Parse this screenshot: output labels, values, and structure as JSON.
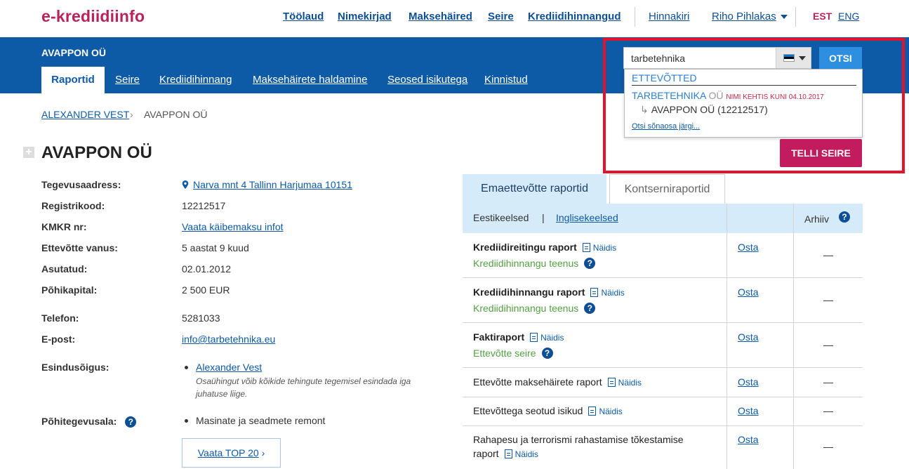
{
  "header": {
    "logo": "e-krediidiinfo",
    "nav": [
      "Töölaud",
      "Nimekirjad",
      "Maksehäired",
      "Seire",
      "Krediidihinnangud"
    ],
    "price_list": "Hinnakiri",
    "user": "Riho Pihlakas",
    "lang_active": "EST",
    "lang_other": "ENG"
  },
  "band": {
    "company": "AVAPPON OÜ",
    "tabs": [
      "Raportid",
      "Seire",
      "Krediidihinnang",
      "Maksehäirete haldamine",
      "Seosed isikutega",
      "Kinnistud"
    ]
  },
  "search": {
    "value": "tarbetehnika",
    "button": "OTSI",
    "dropdown": {
      "heading": "ETTEVÕTTED",
      "result_name": "TARBETEHNIKA",
      "result_suffix": "OÜ",
      "result_note": "NIMI KEHTIS KUNI 04.10.2017",
      "result_current": "AVAPPON OÜ (12212517)",
      "more_link": "Otsi sõnaosa järgi..."
    },
    "monitor_button": "TELLI SEIRE"
  },
  "breadcrumb": {
    "parent": "ALEXANDER VEST",
    "current": "AVAPPON OÜ"
  },
  "company": {
    "title": "AVAPPON OÜ",
    "fields": {
      "address_label": "Tegevusaadress:",
      "address": "Narva mnt 4 Tallinn Harjumaa 10151",
      "regcode_label": "Registrikood:",
      "regcode": "12212517",
      "vat_label": "KMKR nr:",
      "vat": "Vaata käibemaksu infot",
      "age_label": "Ettevõtte vanus:",
      "age": "5 aastat 9 kuud",
      "founded_label": "Asutatud:",
      "founded": "02.01.2012",
      "capital_label": "Põhikapital:",
      "capital": "2 500 EUR",
      "phone_label": "Telefon:",
      "phone": "5281033",
      "email_label": "E-post:",
      "email": "info@tarbetehnika.eu",
      "rep_label": "Esindusõigus:",
      "rep_name": "Alexander Vest",
      "rep_note": "Osaühingut võib kõikide tehingute tegemisel esindada iga juhatuse liige.",
      "activity_label": "Põhitegevusala:",
      "activity": "Masinate ja seadmete remont",
      "top20": "Vaata TOP 20"
    }
  },
  "reports": {
    "tab_parent": "Emaettevõtte raportid",
    "tab_group": "Kontserniraportid",
    "lang_et": "Eestikeelsed",
    "lang_en": "Inglisekeelsed",
    "archive": "Arhiiv",
    "sample": "Näidis",
    "buy": "Osta",
    "dash": "—",
    "rows": [
      {
        "title": "Krediidireitingu raport",
        "sub": "Krediidihinnangu teenus"
      },
      {
        "title": "Krediidihinnangu raport",
        "sub": "Krediidihinnangu teenus"
      },
      {
        "title": "Faktiraport",
        "sub": "Ettevõtte seire"
      },
      {
        "title": "Ettevõtte maksehäirete raport"
      },
      {
        "title": "Ettevõttega seotud isikud"
      },
      {
        "title": "Rahapesu ja terrorismi rahastamise tõkestamise raport"
      }
    ]
  }
}
